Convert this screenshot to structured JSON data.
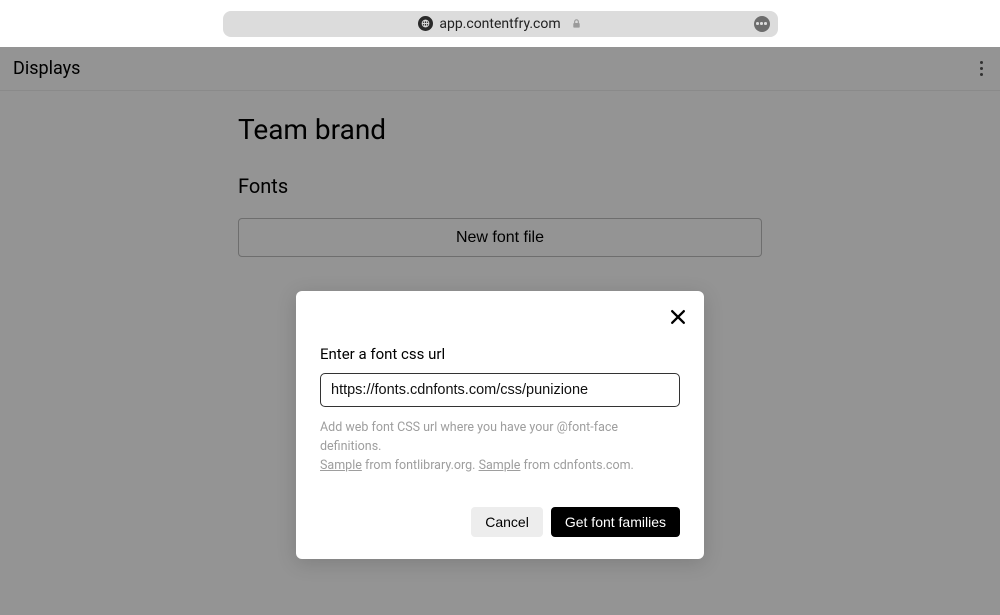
{
  "browser": {
    "url": "app.contentfry.com"
  },
  "page": {
    "header": "Displays",
    "title": "Team brand",
    "section": "Fonts",
    "new_font_button": "New font file"
  },
  "modal": {
    "label": "Enter a font css url",
    "input_value": "https://fonts.cdnfonts.com/css/punizione",
    "helper_line1": "Add web font CSS url where you have your @font-face definitions.",
    "sample1_text": "Sample",
    "sample1_rest": " from fontlibrary.org. ",
    "sample2_text": "Sample",
    "sample2_rest": " from cdnfonts.com.",
    "cancel": "Cancel",
    "submit": "Get font families"
  }
}
